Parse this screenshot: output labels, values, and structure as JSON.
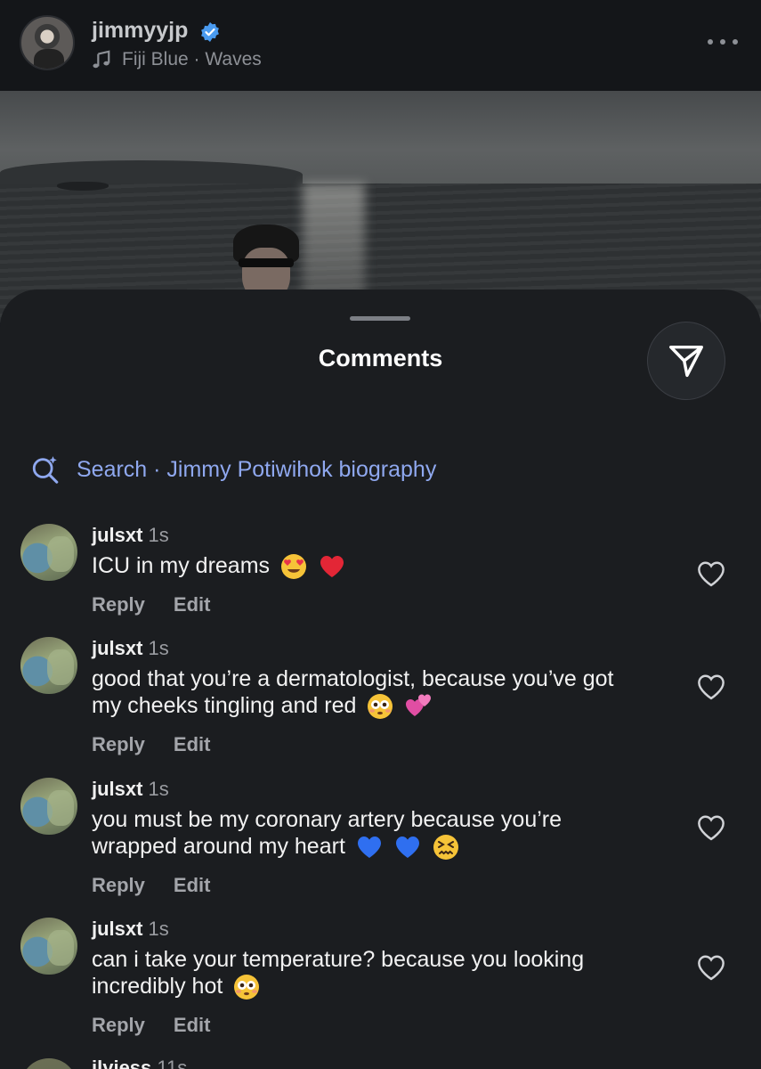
{
  "header": {
    "username": "jimmyyjp",
    "verified_icon": "verified-badge-icon",
    "music_text": "Fiji Blue · Waves",
    "more_icon": "more-options-icon"
  },
  "comments_sheet": {
    "title": "Comments",
    "share_icon": "send-icon",
    "search_label": "Search · Jimmy Potiwihok biography",
    "comments": [
      {
        "user": "julsxt",
        "time": "1s",
        "text": "ICU in my dreams",
        "emojis": [
          "heart-eyes-face",
          "red-heart"
        ],
        "reply": "Reply",
        "edit": "Edit"
      },
      {
        "user": "julsxt",
        "time": "1s",
        "text": "good that you’re a dermatologist, because you’ve got my cheeks tingling and red",
        "emojis": [
          "flushed-face",
          "two-hearts"
        ],
        "reply": "Reply",
        "edit": "Edit"
      },
      {
        "user": "julsxt",
        "time": "1s",
        "text": "you must be my coronary artery because you’re wrapped around my heart",
        "emojis": [
          "blue-heart",
          "blue-heart",
          "confounded-face"
        ],
        "reply": "Reply",
        "edit": "Edit"
      },
      {
        "user": "julsxt",
        "time": "1s",
        "text": "can i take your temperature? because you looking incredibly hot",
        "emojis": [
          "flushed-face"
        ],
        "reply": "Reply",
        "edit": "Edit"
      }
    ],
    "partial_comment": {
      "user": "ilyjess",
      "time": "11s"
    }
  }
}
